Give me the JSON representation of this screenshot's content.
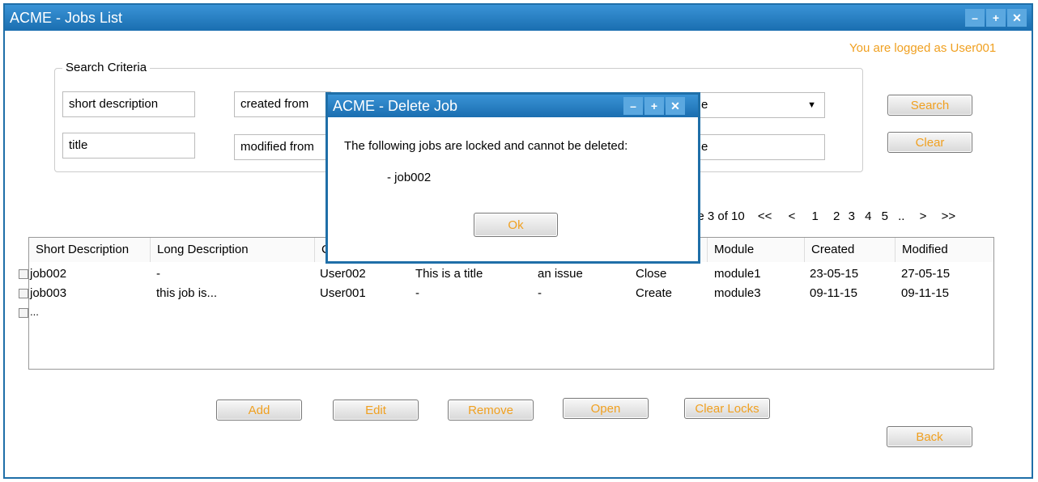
{
  "window": {
    "title": "ACME - Jobs List",
    "controls": [
      "–",
      "+",
      "✕"
    ]
  },
  "user_status": "You are logged as User001",
  "search": {
    "legend": "Search Criteria",
    "short_description": "short description",
    "title": "title",
    "created_from": "created from",
    "modified_from": "modified from",
    "right_field_1": "e",
    "right_field_2": "e",
    "search_label": "Search",
    "clear_label": "Clear"
  },
  "pagination": {
    "text": "je 3 of 10",
    "first": "<<",
    "prev": "<",
    "pages": [
      "1",
      "2",
      "3",
      "4",
      "5"
    ],
    "ellipsis": "..",
    "next": ">",
    "last": ">>"
  },
  "table": {
    "headers": [
      "Short Description",
      "Long Description",
      "C",
      "",
      "",
      "",
      "Module",
      "Created",
      "Modified"
    ],
    "rows": [
      {
        "short": "job002",
        "long": "-",
        "owner": "User002",
        "title": "This is a title",
        "issue": "an issue",
        "action": "Close",
        "module": "module1",
        "created": "23-05-15",
        "modified": "27-05-15"
      },
      {
        "short": "job003",
        "long": "this job is...",
        "owner": "User001",
        "title": "-",
        "issue": "-",
        "action": "Create",
        "module": "module3",
        "created": "09-11-15",
        "modified": "09-11-15"
      },
      {
        "short": "..."
      }
    ]
  },
  "actions": {
    "add": "Add",
    "edit": "Edit",
    "remove": "Remove",
    "open": "Open",
    "clear_locks": "Clear Locks",
    "back": "Back"
  },
  "dialog": {
    "title": "ACME - Delete Job",
    "message": "The following jobs are locked and cannot be deleted:",
    "item": "- job002",
    "ok_label": "Ok"
  },
  "colors": {
    "titlebar": "#1f6fa8",
    "accent": "#f0a020"
  }
}
